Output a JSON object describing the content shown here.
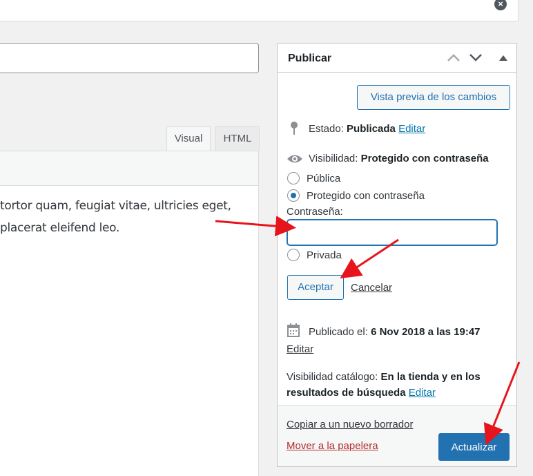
{
  "editor": {
    "tabs": [
      {
        "label": "Visual"
      },
      {
        "label": "HTML"
      }
    ],
    "content_lines": [
      "tortor quam, feugiat vitae, ultricies eget,",
      "placerat eleifend leo."
    ]
  },
  "publish": {
    "title": "Publicar",
    "preview_label": "Vista previa de los cambios",
    "status": {
      "label": "Estado:",
      "value": "Publicada",
      "edit": "Editar"
    },
    "visibility": {
      "label": "Visibilidad:",
      "value": "Protegido con contraseña",
      "options": [
        {
          "label": "Pública",
          "checked": false
        },
        {
          "label": "Protegido con contraseña",
          "checked": true
        },
        {
          "label": "Privada",
          "checked": false
        }
      ],
      "password_label": "Contraseña:",
      "password_value": "",
      "accept_label": "Aceptar",
      "cancel_label": "Cancelar"
    },
    "published": {
      "label": "Publicado el:",
      "value": "6 Nov 2018 a las 19:47",
      "edit": "Editar"
    },
    "catalog": {
      "label": "Visibilidad catálogo:",
      "value_line1": "En la tienda y en los",
      "value_line2": "resultados de búsqueda",
      "edit": "Editar"
    },
    "copy_draft_label": "Copiar a un nuevo borrador",
    "trash_label": "Mover a la papelera",
    "update_label": "Actualizar"
  },
  "colors": {
    "accent": "#2271b1",
    "danger": "#b32d2e",
    "annotation": "#e8141c"
  },
  "icons": {
    "close": "close-icon",
    "status": "pin-icon",
    "visibility": "eye-icon",
    "published": "calendar-icon"
  }
}
